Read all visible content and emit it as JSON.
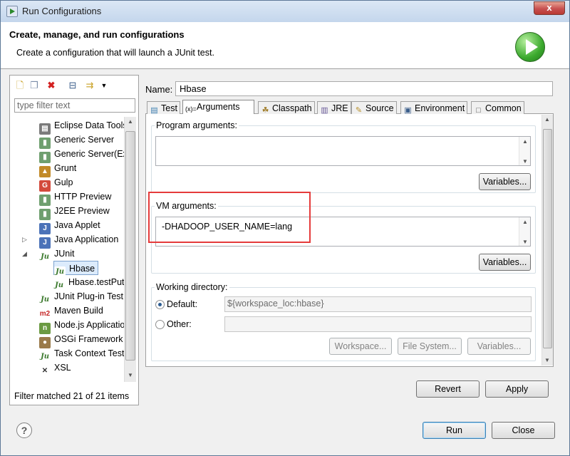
{
  "window": {
    "title": "Run Configurations",
    "close_glyph": "x"
  },
  "header": {
    "heading": "Create, manage, and run configurations",
    "description": "Create a configuration that will launch a JUnit test."
  },
  "left_panel": {
    "filter_placeholder": "type filter text",
    "tree": [
      {
        "label": "Eclipse Data Tools",
        "icon": "db-icon",
        "color": "#7b7b7b",
        "glyph": "▤"
      },
      {
        "label": "Generic Server",
        "icon": "server-icon",
        "color": "#6f9f6f",
        "glyph": "▮"
      },
      {
        "label": "Generic Server(Exte",
        "icon": "server-icon",
        "color": "#6f9f6f",
        "glyph": "▮"
      },
      {
        "label": "Grunt",
        "icon": "grunt-icon",
        "color": "#c28a28",
        "glyph": "▲"
      },
      {
        "label": "Gulp",
        "icon": "gulp-icon",
        "color": "#d34a3c",
        "glyph": "G"
      },
      {
        "label": "HTTP Preview",
        "icon": "http-icon",
        "color": "#6f9f6f",
        "glyph": "▮"
      },
      {
        "label": "J2EE Preview",
        "icon": "j2ee-icon",
        "color": "#6f9f6f",
        "glyph": "▮"
      },
      {
        "label": "Java Applet",
        "icon": "applet-icon",
        "color": "#4b72b8",
        "glyph": "J"
      },
      {
        "label": "Java Application",
        "icon": "java-app-icon",
        "color": "#4b72b8",
        "glyph": "J"
      },
      {
        "label": "JUnit",
        "icon": "junit-icon",
        "color": "#ffffff",
        "glyph": "Ju"
      },
      {
        "label": "Hbase",
        "icon": "junit-icon",
        "color": "#ffffff",
        "glyph": "Ju"
      },
      {
        "label": "Hbase.testPut",
        "icon": "junit-icon",
        "color": "#ffffff",
        "glyph": "Ju"
      },
      {
        "label": "JUnit Plug-in Test",
        "icon": "junit-plugin-icon",
        "color": "#ffffff",
        "glyph": "Ju"
      },
      {
        "label": "Maven Build",
        "icon": "maven-icon",
        "color": "#ffffff",
        "glyph": "m2"
      },
      {
        "label": "Node.js Application",
        "icon": "nodejs-icon",
        "color": "#6b9a42",
        "glyph": "n"
      },
      {
        "label": "OSGi Framework",
        "icon": "osgi-icon",
        "color": "#9a7a4a",
        "glyph": "●"
      },
      {
        "label": "Task Context Test",
        "icon": "task-icon",
        "color": "#ffffff",
        "glyph": "Ju"
      },
      {
        "label": "XSL",
        "icon": "xsl-icon",
        "color": "#ffffff",
        "glyph": "✕"
      }
    ],
    "filter_status": "Filter matched 21 of 21 items"
  },
  "config": {
    "name_label": "Name:",
    "name_value": "Hbase",
    "tabs": [
      {
        "label": "Test",
        "icon": "test-tab-icon"
      },
      {
        "label": "Arguments",
        "icon": "arguments-tab-icon"
      },
      {
        "label": "Classpath",
        "icon": "classpath-tab-icon"
      },
      {
        "label": "JRE",
        "icon": "jre-tab-icon"
      },
      {
        "label": "Source",
        "icon": "source-tab-icon"
      },
      {
        "label": "Environment",
        "icon": "environment-tab-icon"
      },
      {
        "label": "Common",
        "icon": "common-tab-icon"
      }
    ],
    "active_tab": "Arguments",
    "program_args_label": "Program arguments:",
    "program_args_value": "",
    "variables_label": "Variables...",
    "vm_args_label": "VM arguments:",
    "vm_args_value": "-DHADOOP_USER_NAME=lang",
    "working_dir_label": "Working directory:",
    "default_label": "Default:",
    "default_value": "${workspace_loc:hbase}",
    "other_label": "Other:",
    "workspace_btn": "Workspace...",
    "filesystem_btn": "File System...",
    "variables_btn": "Variables..."
  },
  "buttons": {
    "revert": "Revert",
    "apply": "Apply",
    "run": "Run",
    "close": "Close",
    "help": "?"
  }
}
